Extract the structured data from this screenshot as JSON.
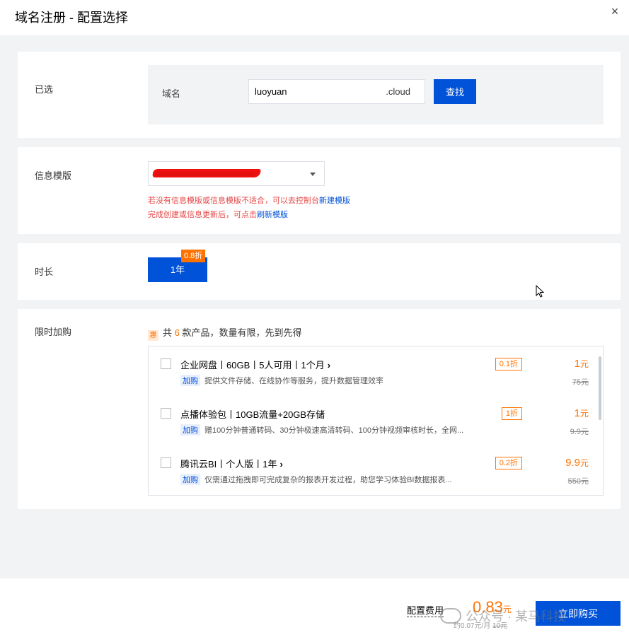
{
  "dialog": {
    "title": "域名注册 - 配置选择",
    "close_icon": "×"
  },
  "selected": {
    "label": "已选",
    "domain_label": "域名",
    "domain_value": "luoyuan",
    "domain_suffix": ".cloud",
    "search_button": "查找"
  },
  "template": {
    "label": "信息模版",
    "tip_line1_text": "若没有信息模版或信息模版不适合，可以去控制台",
    "tip_line1_link": "新建模版",
    "tip_line2_text": "完成创建或信息更新后，可点击",
    "tip_line2_link": "刷新模版"
  },
  "duration": {
    "label": "时长",
    "option": "1年",
    "discount_tag": "0.8折"
  },
  "addon": {
    "label": "限时加购",
    "promo_icon": "惠",
    "promo_prefix": "共",
    "promo_count": "6",
    "promo_suffix": "款产品，数量有限，先到先得",
    "products": [
      {
        "title": "企业网盘丨60GB丨5人可用丨1个月",
        "has_chevron": true,
        "badge": "加购",
        "desc": "提供文件存储、在线协作等服务，提升数据管理效率",
        "discount": "0.1折",
        "price": "1",
        "unit": "元",
        "original": "75元"
      },
      {
        "title": "点播体验包丨10GB流量+20GB存储",
        "has_chevron": false,
        "badge": "加购",
        "desc": "赠100分钟普通转码、30分钟极速高清转码、100分钟视频审核时长，全网...",
        "discount": "1折",
        "price": "1",
        "unit": "元",
        "original": "9.9元"
      },
      {
        "title": "腾讯云BI丨个人版丨1年",
        "has_chevron": true,
        "badge": "加购",
        "desc": "仅需通过拖拽即可完成复杂的报表开发过程，助您学习体验BI数据报表...",
        "discount": "0.2折",
        "price": "9.9",
        "unit": "元",
        "original": "550元"
      }
    ]
  },
  "footer": {
    "fee_label": "配置费用",
    "fee_value": "0.83",
    "fee_unit": "元",
    "fee_sub_prefix": "约0.07元/月",
    "fee_sub_orig": "10元",
    "buy_button": "立即购买"
  },
  "watermark": {
    "text": "公众号 · 某马科技"
  },
  "colors": {
    "primary": "#0052d9",
    "accent": "#ff7200",
    "warning_text": "#e54545",
    "background": "#f2f3f5"
  }
}
